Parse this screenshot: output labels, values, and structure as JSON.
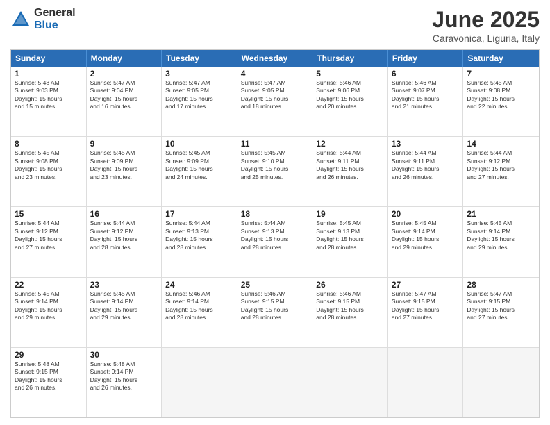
{
  "logo": {
    "general": "General",
    "blue": "Blue"
  },
  "title": "June 2025",
  "location": "Caravonica, Liguria, Italy",
  "header_days": [
    "Sunday",
    "Monday",
    "Tuesday",
    "Wednesday",
    "Thursday",
    "Friday",
    "Saturday"
  ],
  "weeks": [
    [
      {
        "day": "1",
        "lines": [
          "Sunrise: 5:48 AM",
          "Sunset: 9:03 PM",
          "Daylight: 15 hours",
          "and 15 minutes."
        ]
      },
      {
        "day": "2",
        "lines": [
          "Sunrise: 5:47 AM",
          "Sunset: 9:04 PM",
          "Daylight: 15 hours",
          "and 16 minutes."
        ]
      },
      {
        "day": "3",
        "lines": [
          "Sunrise: 5:47 AM",
          "Sunset: 9:05 PM",
          "Daylight: 15 hours",
          "and 17 minutes."
        ]
      },
      {
        "day": "4",
        "lines": [
          "Sunrise: 5:47 AM",
          "Sunset: 9:05 PM",
          "Daylight: 15 hours",
          "and 18 minutes."
        ]
      },
      {
        "day": "5",
        "lines": [
          "Sunrise: 5:46 AM",
          "Sunset: 9:06 PM",
          "Daylight: 15 hours",
          "and 20 minutes."
        ]
      },
      {
        "day": "6",
        "lines": [
          "Sunrise: 5:46 AM",
          "Sunset: 9:07 PM",
          "Daylight: 15 hours",
          "and 21 minutes."
        ]
      },
      {
        "day": "7",
        "lines": [
          "Sunrise: 5:45 AM",
          "Sunset: 9:08 PM",
          "Daylight: 15 hours",
          "and 22 minutes."
        ]
      }
    ],
    [
      {
        "day": "8",
        "lines": [
          "Sunrise: 5:45 AM",
          "Sunset: 9:08 PM",
          "Daylight: 15 hours",
          "and 23 minutes."
        ]
      },
      {
        "day": "9",
        "lines": [
          "Sunrise: 5:45 AM",
          "Sunset: 9:09 PM",
          "Daylight: 15 hours",
          "and 23 minutes."
        ]
      },
      {
        "day": "10",
        "lines": [
          "Sunrise: 5:45 AM",
          "Sunset: 9:09 PM",
          "Daylight: 15 hours",
          "and 24 minutes."
        ]
      },
      {
        "day": "11",
        "lines": [
          "Sunrise: 5:45 AM",
          "Sunset: 9:10 PM",
          "Daylight: 15 hours",
          "and 25 minutes."
        ]
      },
      {
        "day": "12",
        "lines": [
          "Sunrise: 5:44 AM",
          "Sunset: 9:11 PM",
          "Daylight: 15 hours",
          "and 26 minutes."
        ]
      },
      {
        "day": "13",
        "lines": [
          "Sunrise: 5:44 AM",
          "Sunset: 9:11 PM",
          "Daylight: 15 hours",
          "and 26 minutes."
        ]
      },
      {
        "day": "14",
        "lines": [
          "Sunrise: 5:44 AM",
          "Sunset: 9:12 PM",
          "Daylight: 15 hours",
          "and 27 minutes."
        ]
      }
    ],
    [
      {
        "day": "15",
        "lines": [
          "Sunrise: 5:44 AM",
          "Sunset: 9:12 PM",
          "Daylight: 15 hours",
          "and 27 minutes."
        ]
      },
      {
        "day": "16",
        "lines": [
          "Sunrise: 5:44 AM",
          "Sunset: 9:12 PM",
          "Daylight: 15 hours",
          "and 28 minutes."
        ]
      },
      {
        "day": "17",
        "lines": [
          "Sunrise: 5:44 AM",
          "Sunset: 9:13 PM",
          "Daylight: 15 hours",
          "and 28 minutes."
        ]
      },
      {
        "day": "18",
        "lines": [
          "Sunrise: 5:44 AM",
          "Sunset: 9:13 PM",
          "Daylight: 15 hours",
          "and 28 minutes."
        ]
      },
      {
        "day": "19",
        "lines": [
          "Sunrise: 5:45 AM",
          "Sunset: 9:13 PM",
          "Daylight: 15 hours",
          "and 28 minutes."
        ]
      },
      {
        "day": "20",
        "lines": [
          "Sunrise: 5:45 AM",
          "Sunset: 9:14 PM",
          "Daylight: 15 hours",
          "and 29 minutes."
        ]
      },
      {
        "day": "21",
        "lines": [
          "Sunrise: 5:45 AM",
          "Sunset: 9:14 PM",
          "Daylight: 15 hours",
          "and 29 minutes."
        ]
      }
    ],
    [
      {
        "day": "22",
        "lines": [
          "Sunrise: 5:45 AM",
          "Sunset: 9:14 PM",
          "Daylight: 15 hours",
          "and 29 minutes."
        ]
      },
      {
        "day": "23",
        "lines": [
          "Sunrise: 5:45 AM",
          "Sunset: 9:14 PM",
          "Daylight: 15 hours",
          "and 29 minutes."
        ]
      },
      {
        "day": "24",
        "lines": [
          "Sunrise: 5:46 AM",
          "Sunset: 9:14 PM",
          "Daylight: 15 hours",
          "and 28 minutes."
        ]
      },
      {
        "day": "25",
        "lines": [
          "Sunrise: 5:46 AM",
          "Sunset: 9:15 PM",
          "Daylight: 15 hours",
          "and 28 minutes."
        ]
      },
      {
        "day": "26",
        "lines": [
          "Sunrise: 5:46 AM",
          "Sunset: 9:15 PM",
          "Daylight: 15 hours",
          "and 28 minutes."
        ]
      },
      {
        "day": "27",
        "lines": [
          "Sunrise: 5:47 AM",
          "Sunset: 9:15 PM",
          "Daylight: 15 hours",
          "and 27 minutes."
        ]
      },
      {
        "day": "28",
        "lines": [
          "Sunrise: 5:47 AM",
          "Sunset: 9:15 PM",
          "Daylight: 15 hours",
          "and 27 minutes."
        ]
      }
    ],
    [
      {
        "day": "29",
        "lines": [
          "Sunrise: 5:48 AM",
          "Sunset: 9:15 PM",
          "Daylight: 15 hours",
          "and 26 minutes."
        ]
      },
      {
        "day": "30",
        "lines": [
          "Sunrise: 5:48 AM",
          "Sunset: 9:14 PM",
          "Daylight: 15 hours",
          "and 26 minutes."
        ]
      },
      {
        "day": "",
        "lines": []
      },
      {
        "day": "",
        "lines": []
      },
      {
        "day": "",
        "lines": []
      },
      {
        "day": "",
        "lines": []
      },
      {
        "day": "",
        "lines": []
      }
    ]
  ]
}
